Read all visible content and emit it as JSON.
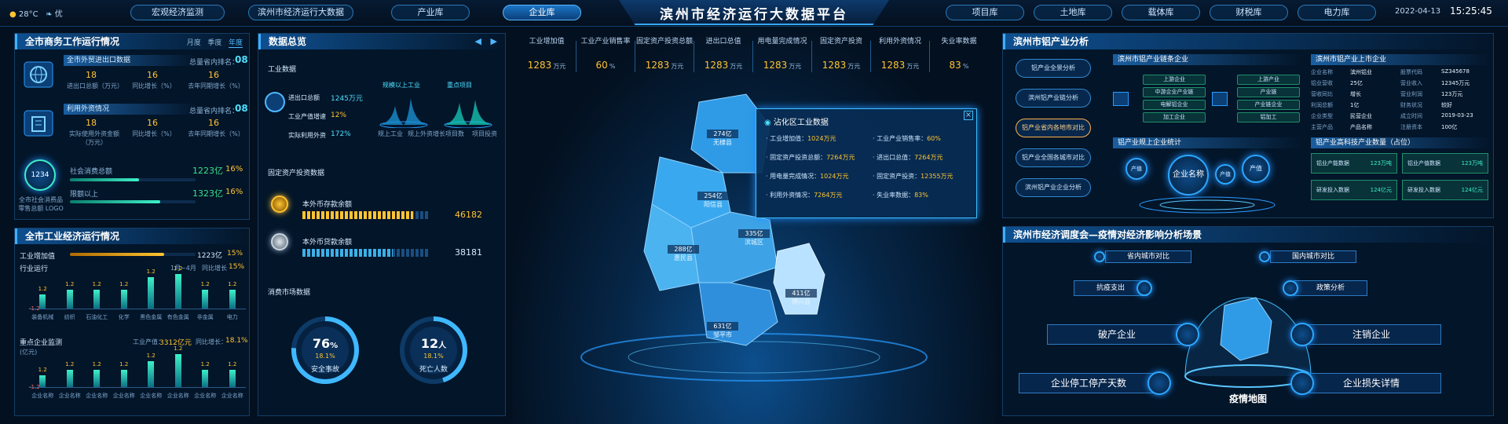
{
  "header": {
    "title": "滨州市经济运行大数据平台",
    "weather_temp": "28°C",
    "air_quality": "优",
    "date": "2022-04-13",
    "time": "15:25:45",
    "nav_left": [
      "宏观经济监测",
      "滨州市经济运行大数据",
      "产业库",
      "企业库"
    ],
    "nav_right": [
      "项目库",
      "土地库",
      "载体库",
      "财税库",
      "电力库"
    ],
    "active_tab": "企业库"
  },
  "commerce": {
    "title": "全市商务工作运行情况",
    "tabs": [
      "月度",
      "季度",
      "年度"
    ],
    "block1": {
      "name": "全市外贸进出口数据",
      "rank_label": "总量省内排名：",
      "rank": "08",
      "cells": [
        {
          "value": "18",
          "label": "进出口总额（万元）"
        },
        {
          "value": "16",
          "label": "同比增长（%）"
        },
        {
          "value": "16",
          "label": "去年同期增长（%）"
        }
      ]
    },
    "block2": {
      "name": "利用外资情况",
      "rank_label": "总量省内排名：",
      "rank": "08",
      "cells": [
        {
          "value": "18",
          "label": "实际使用外资金额（万元）"
        },
        {
          "value": "16",
          "label": "同比增长（%）"
        },
        {
          "value": "16",
          "label": "去年同期增长（%）"
        }
      ]
    },
    "consume": {
      "badge": "1234",
      "label": "全市社会消费品零售总额 LOGO",
      "rows": [
        {
          "name": "社会消费总额",
          "value": "1223亿",
          "pct": "16%",
          "progress": 0.55
        },
        {
          "name": "限额以上",
          "value": "1323亿",
          "pct": "16%",
          "progress": 0.72
        }
      ]
    }
  },
  "industry": {
    "title": "全市工业经济运行情况",
    "row1": {
      "label": "工业增加值",
      "value": "1223亿",
      "pct": "15%",
      "progress": 0.75
    },
    "row2": {
      "label": "行业运行",
      "note": "1月~4月",
      "pct_label": "同比增长",
      "pct": "15%"
    },
    "bars1": {
      "labels": [
        "装备机械",
        "纺织",
        "石油化工",
        "化学",
        "黑色金属",
        "有色金属",
        "非金属",
        "电力"
      ],
      "tags": [
        "1.2",
        "1.2",
        "1.2",
        "1.2",
        "1.2",
        "1.2",
        "1.2",
        "1.2"
      ],
      "first_tag": "1.2",
      "neg_tag": "-1.2",
      "values": [
        0.4,
        0.55,
        0.55,
        0.55,
        0.9,
        1.0,
        0.55,
        0.55
      ]
    },
    "row3": {
      "label": "重点企业监测",
      "prod_label": "工业产值：",
      "prod": "3312亿元",
      "pct_label": "同比增长：",
      "pct": "18.1%"
    },
    "bars2": {
      "unit": "(亿元)",
      "labels": [
        "企业名称",
        "企业名称",
        "企业名称",
        "企业名称",
        "企业名称",
        "企业名称",
        "企业名称",
        "企业名称"
      ],
      "tags": [
        "1.2",
        "1.2",
        "1.2",
        "1.2",
        "1.2",
        "1.2",
        "1.2",
        "1.2"
      ],
      "neg_tag": "-1.2",
      "values": [
        0.35,
        0.5,
        0.5,
        0.5,
        0.75,
        0.95,
        0.5,
        0.5
      ]
    }
  },
  "overview": {
    "title": "数据总览",
    "industry_data": {
      "section": "工业数据",
      "rows": [
        {
          "name": "进出口总额",
          "value": "1245万元"
        },
        {
          "name": "工业产值增速",
          "value": "12%"
        },
        {
          "name": "实际利用外资",
          "value": "172%"
        }
      ],
      "charts": [
        {
          "title": "规模以上工业",
          "left": "规上工业",
          "right": "规上外资增长"
        },
        {
          "title": "重点项目",
          "left": "项目数",
          "right": "项目投资"
        }
      ]
    },
    "fixed_invest": {
      "section": "固定资产投资数据",
      "rows": [
        {
          "name": "本外币存款余额",
          "value": "46182",
          "progress": 0.88
        },
        {
          "name": "本外币贷款余额",
          "value": "38181",
          "progress": 0.72
        }
      ]
    },
    "consumption": {
      "section": "消费市场数据",
      "gauges": [
        {
          "value": "76",
          "unit": "%",
          "sub": "18.1%",
          "label": "安全事故",
          "ratio": 0.76
        },
        {
          "value": "12",
          "unit": "人",
          "sub": "18.1%",
          "label": "死亡人数",
          "ratio": 0.45
        }
      ]
    }
  },
  "stats": [
    {
      "label": "工业增加值",
      "value": "1283",
      "unit": "万元"
    },
    {
      "label": "工业产业销售率",
      "value": "60",
      "unit": "%"
    },
    {
      "label": "固定资产投资总额",
      "value": "1283",
      "unit": "万元"
    },
    {
      "label": "进出口总值",
      "value": "1283",
      "unit": "万元"
    },
    {
      "label": "用电量完成情况",
      "value": "1283",
      "unit": "万元"
    },
    {
      "label": "固定资产投资",
      "value": "1283",
      "unit": "万元"
    },
    {
      "label": "利用外资情况",
      "value": "1283",
      "unit": "万元"
    },
    {
      "label": "失业率数据",
      "value": "83",
      "unit": "%"
    }
  ],
  "map": {
    "regions": [
      {
        "value": "274亿",
        "name": "无棣县"
      },
      {
        "value": "254亿",
        "name": "阳信县"
      },
      {
        "value": "288亿",
        "name": "惠民县"
      },
      {
        "value": "335亿",
        "name": "滨城区"
      },
      {
        "value": "411亿",
        "name": "博兴县"
      },
      {
        "value": "631亿",
        "name": "邹平市"
      }
    ],
    "popup": {
      "title": "沾化区工业数据",
      "items": [
        {
          "name": "工业增加值",
          "value": "1024万元"
        },
        {
          "name": "工业产业销售率",
          "value": "60%"
        },
        {
          "name": "固定资产投资总额",
          "value": "7264万元"
        },
        {
          "name": "进出口总值",
          "value": "7264万元"
        },
        {
          "name": "用电量完成情况",
          "value": "1024万元"
        },
        {
          "name": "固定资产投资",
          "value": "12355万元"
        },
        {
          "name": "利用外资情况",
          "value": "7264万元"
        },
        {
          "name": "失业率数据",
          "value": "83%"
        }
      ]
    }
  },
  "alum": {
    "title": "滨州市铝产业分析",
    "buttons": [
      "铝产业全景分析",
      "滨州铝产业链分析",
      "铝产业省内各地市对比",
      "铝产业全国各城市对比",
      "滨州铝产业企业分析"
    ],
    "chain_title": "滨州市铝产业链条企业",
    "chain_left": [
      "上游企业",
      "中游企业产业链",
      "电解铝企业",
      "加工企业"
    ],
    "chain_right": [
      "上游产业",
      "产业链",
      "产业链企业",
      "铝加工"
    ],
    "listed_title": "滨州市铝产业上市企业",
    "listed": [
      [
        "企业名称",
        "滨州铝业",
        "股票代码",
        "SZ345678"
      ],
      [
        "铝业营收",
        "25亿",
        "营业收入",
        "12345万元"
      ],
      [
        "营收同比",
        "增长",
        "营业利润",
        "123万元"
      ],
      [
        "利润总额",
        "1亿",
        "财务状况",
        "较好"
      ],
      [
        "企业类型",
        "民营企业",
        "成立时间",
        "2019-03-23"
      ],
      [
        "主营产品",
        "产品名称",
        "注册资本",
        "100亿"
      ]
    ],
    "stat_title": "铝产业规上企业统计",
    "bubbles": [
      "企业名称",
      "产值",
      "产值",
      "产值"
    ],
    "tech_title": "铝产业高科技产业数量（占位）",
    "tech": [
      {
        "name": "铝业产能数据",
        "value": "123万吨"
      },
      {
        "name": "铝业产值数据",
        "value": "123万吨"
      },
      {
        "name": "研发投入数据",
        "value": "124亿元"
      },
      {
        "name": "研发投入数据",
        "value": "124亿元"
      }
    ]
  },
  "epi": {
    "title": "滨州市经济调度会—疫情对经济影响分析场景",
    "buttons": [
      {
        "label": "破产企业",
        "icon": "hammer-icon"
      },
      {
        "label": "注销企业",
        "icon": "power-icon"
      },
      {
        "label": "企业停工停产天数",
        "icon": "calendar-icon"
      },
      {
        "label": "企业损失详情",
        "icon": "chart-icon"
      },
      {
        "label": "抗疫支出",
        "icon": "briefcase-icon"
      },
      {
        "label": "政策分析",
        "icon": "book-icon"
      },
      {
        "label": "省内城市对比",
        "icon": "compare-icon"
      },
      {
        "label": "国内城市对比",
        "icon": "globe-icon"
      }
    ],
    "map_label": "疫情地图"
  }
}
